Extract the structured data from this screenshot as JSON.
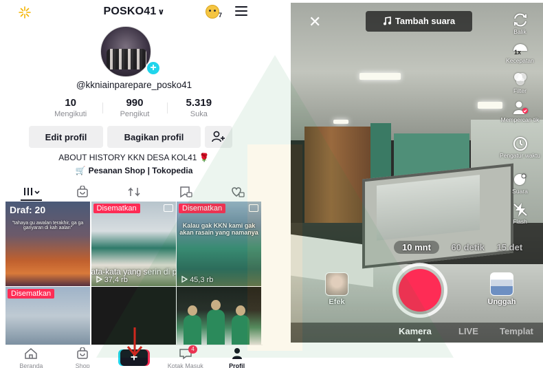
{
  "left": {
    "header": {
      "title": "POSKO41",
      "notification_count": "7"
    },
    "profile": {
      "username": "@kkniainparepare_posko41",
      "stats": [
        {
          "value": "10",
          "label": "Mengikuti"
        },
        {
          "value": "990",
          "label": "Pengikut"
        },
        {
          "value": "5.319",
          "label": "Suka"
        }
      ],
      "edit_label": "Edit profil",
      "share_label": "Bagikan profil",
      "bio": "ABOUT HISTORY KKN DESA KOL41 🌹",
      "shop_link": "Pesanan Shop | Tokopedia"
    },
    "grid": {
      "draft_label": "Draf: 20",
      "pinned_label": "Disematkan",
      "tile1_overlay": "\"tahaya gu awalan terakhir, ga ga ganyaran di kah aalan\"",
      "tile2_caption": "ata-kata yang serin di posko",
      "tile2_views": "37,4 rb",
      "tile3_overlay": "Kalau gak KKN kami gak akan rasain yang namanya",
      "tile3_views": "45,3 rb"
    },
    "nav": {
      "home": "Beranda",
      "shop": "Shop",
      "create": "+",
      "inbox": "Kotak Masuk",
      "inbox_badge": "4",
      "profile": "Profil"
    }
  },
  "right": {
    "add_sound_label": "Tambah suara",
    "tools": [
      {
        "label": "Balik",
        "icon": "flip-camera-icon"
      },
      {
        "label": "Kecepatan",
        "icon": "speed-icon"
      },
      {
        "label": "Filter",
        "icon": "filter-icon"
      },
      {
        "label": "Mempercan tik",
        "icon": "beauty-icon"
      },
      {
        "label": "Pengatur waktu",
        "icon": "timer-icon"
      },
      {
        "label": "Suara",
        "icon": "voice-icon"
      },
      {
        "label": "Flash",
        "icon": "flash-icon"
      }
    ],
    "speed_badge": "1x",
    "durations": [
      "10 mnt",
      "60 detik",
      "15 det"
    ],
    "effects_label": "Efek",
    "upload_label": "Unggah",
    "modes": [
      "Kamera",
      "LIVE",
      "Templat"
    ]
  },
  "colors": {
    "accent_red": "#fe2c55",
    "accent_cyan": "#20d5ec",
    "text_dark": "#161823"
  }
}
